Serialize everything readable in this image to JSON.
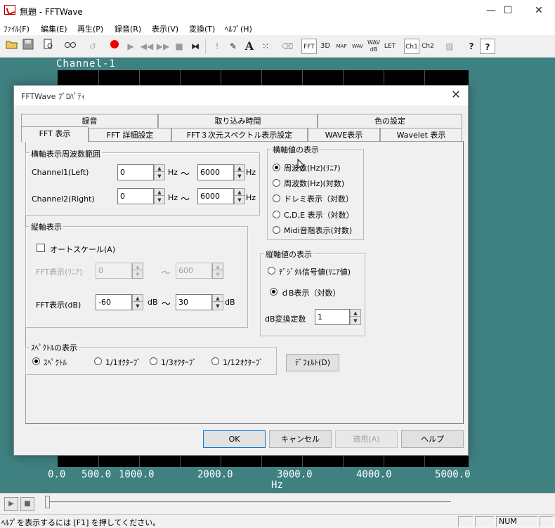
{
  "window": {
    "title": "無題 - FFTWave",
    "minimize": "—",
    "maximize": "☐",
    "close": "✕"
  },
  "menu": [
    "ﾌｧｲﾙ(F)",
    "編集(E)",
    "再生(P)",
    "録音(R)",
    "表示(V)",
    "変換(T)",
    "ﾍﾙﾌﾟ(H)"
  ],
  "toolbar": {
    "fft": "FFT",
    "threed": "3D",
    "map": "MAP",
    "wav": "WAV",
    "wavdb": "WAV dB",
    "let": "LET",
    "ch1": "Ch1",
    "ch2": "Ch2",
    "text_tool": "A",
    "help": "?",
    "context_help": "?"
  },
  "plot": {
    "channel_label": "Channel-1",
    "x_ticks": [
      "0.0",
      "500.0",
      "1000.0",
      "2000.0",
      "3000.0",
      "4000.0",
      "5000.0"
    ],
    "x_unit": "Hz"
  },
  "status": {
    "text": "ﾍﾙﾌﾟを表示するには [F1] を押してください。",
    "num": "NUM"
  },
  "dialog": {
    "title": "FFTWave ﾌﾟﾛﾊﾟﾃｨ",
    "close": "✕",
    "tabs_back": [
      "録音",
      "取り込み時間",
      "色の設定"
    ],
    "tabs_front": [
      "FFT 表示",
      "FFT 詳細設定",
      "FFT３次元スペクトル表示設定",
      "WAVE表示",
      "Wavelet 表示"
    ],
    "freq_range": {
      "title": "横軸表示周波数範囲",
      "ch1_label": "Channel1(Left)",
      "ch1_from": "0",
      "ch1_to": "6000",
      "ch2_label": "Channel2(Right)",
      "ch2_from": "0",
      "ch2_to": "6000",
      "unit_hz": "Hz",
      "tilde": "～"
    },
    "horiz_values": {
      "title": "横軸値の表示",
      "options": [
        "周波数(Hz)(ﾘﾆｱ)",
        "周波数(Hz)(対数)",
        "ドレミ表示（対数）",
        "C,D,E 表示（対数）",
        "Midi音階表示(対数)"
      ],
      "selected": 0
    },
    "vert_axis": {
      "title": "縦軸表示",
      "autoscale": "オートスケール(A)",
      "linear_label": "FFT表示(ﾘﾆｱ)",
      "linear_from": "0",
      "linear_to": "600",
      "db_label": "FFT表示(dB)",
      "db_from": "-60",
      "db_to": "30",
      "db_unit": "dB",
      "tilde": "～"
    },
    "vert_values": {
      "title": "縦軸値の表示",
      "options": [
        "ﾃﾞｼﾞﾀﾙ信号値(ﾘﾆｱ値)",
        "ｄB表示（対数）"
      ],
      "selected": 1,
      "const_label": "dB変換定数",
      "const_value": "1"
    },
    "spectrum": {
      "title": "ｽﾍﾟｸﾄﾙの表示",
      "options": [
        "ｽﾍﾟｸﾄﾙ",
        "1/1ｵｸﾀｰﾌﾞ",
        "1/3ｵｸﾀｰﾌﾞ",
        "1/12ｵｸﾀｰﾌﾞ"
      ],
      "selected": 0
    },
    "default_button": "ﾃﾞﾌｫﾙﾄ(D)",
    "buttons": {
      "ok": "OK",
      "cancel": "キャンセル",
      "apply": "適用(A)",
      "help": "ヘルプ"
    }
  }
}
